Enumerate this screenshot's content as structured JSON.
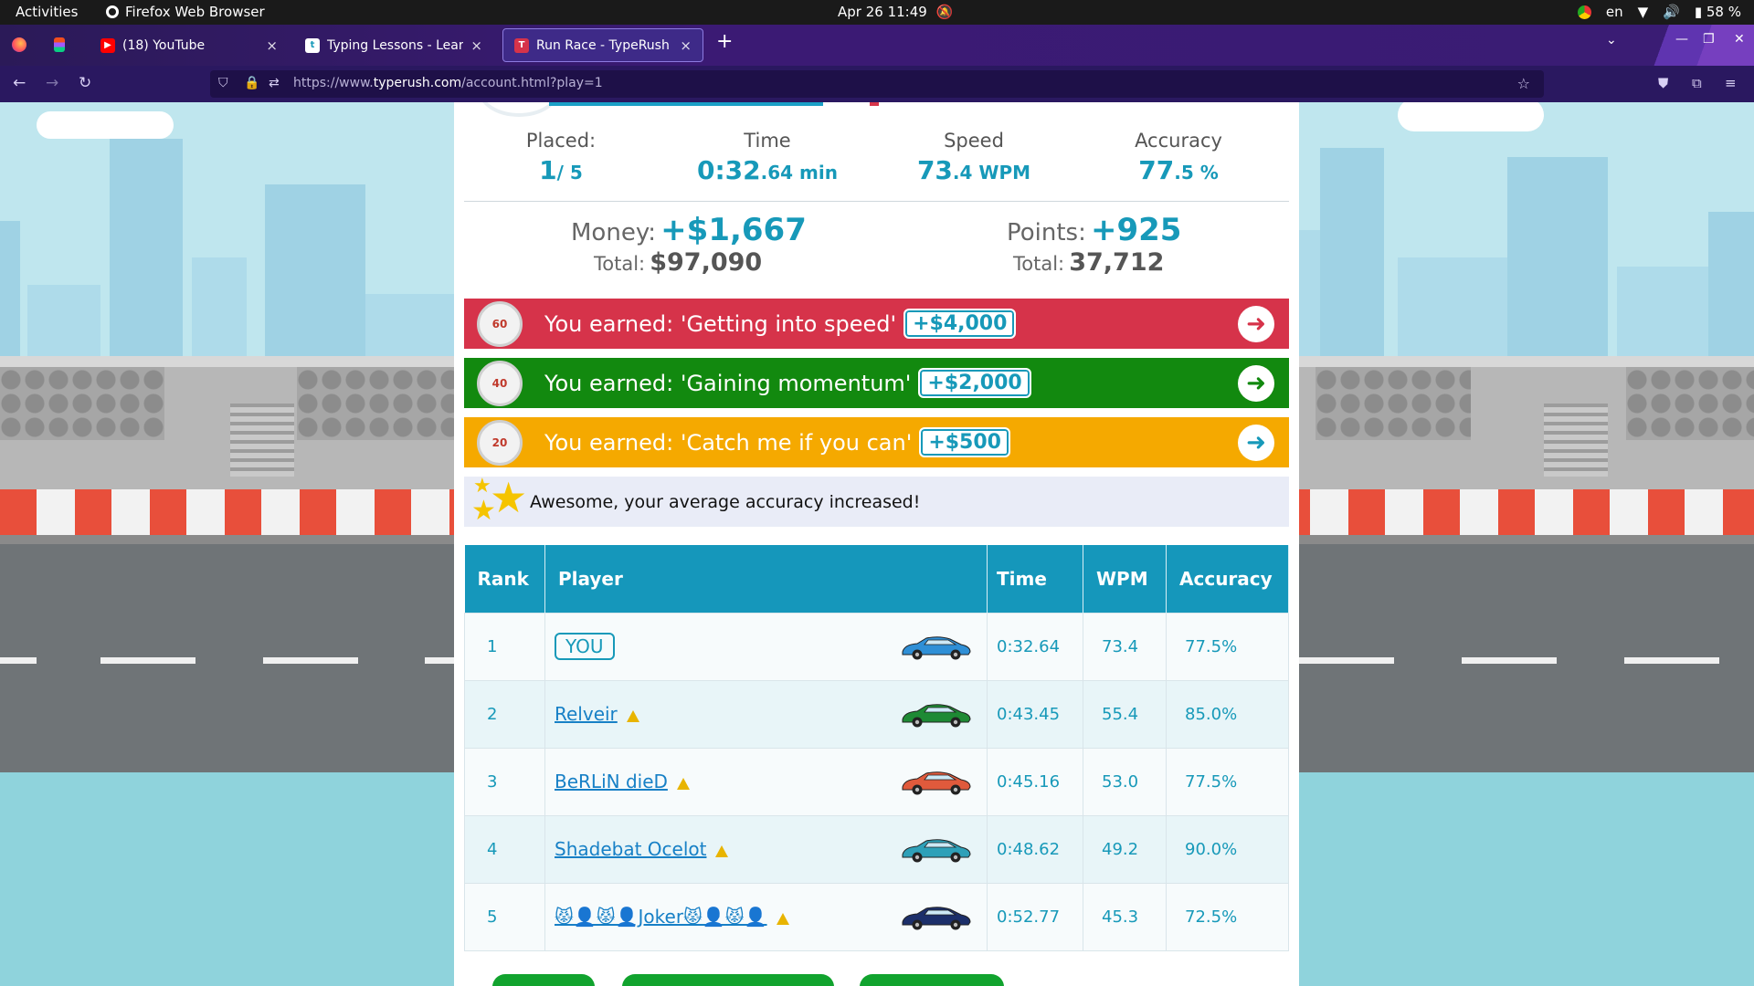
{
  "system": {
    "activities": "Activities",
    "app_name": "Firefox Web Browser",
    "datetime": "Apr 26  11:49",
    "language": "en",
    "battery": "58 %"
  },
  "tabs": [
    {
      "label": "(18) YouTube",
      "close": "×"
    },
    {
      "label": "Typing Lessons - Learn To",
      "close": "×"
    },
    {
      "label": "Run Race - TypeRush",
      "close": "×"
    }
  ],
  "newtab": "+",
  "nav": {
    "url_prefix": "https://www.",
    "url_domain": "typerush.com",
    "url_path": "/account.html?play=1"
  },
  "stats": {
    "placed_label": "Placed:",
    "placed_main": "1",
    "placed_suffix": "/ 5",
    "time_label": "Time",
    "time_main": "0:32",
    "time_suffix": ".64 min",
    "speed_label": "Speed",
    "speed_main": "73",
    "speed_suffix": ".4 WPM",
    "accuracy_label": "Accuracy",
    "accuracy_main": "77",
    "accuracy_suffix": ".5 %"
  },
  "rewards": {
    "money_label": "Money:",
    "money_value": "+$1,667",
    "money_total_label": "Total:",
    "money_total": "$97,090",
    "points_label": "Points:",
    "points_value": "+925",
    "points_total_label": "Total:",
    "points_total": "37,712"
  },
  "awards": [
    {
      "text": "You earned: 'Getting into speed'",
      "bonus": "+$4,000",
      "badge": "60",
      "color": "#d6334a"
    },
    {
      "text": "You earned: 'Gaining momentum'",
      "bonus": "+$2,000",
      "badge": "40",
      "color": "#12890f"
    },
    {
      "text": "You earned: 'Catch me if you can'",
      "bonus": "+$500",
      "badge": "20",
      "color": "#f5a900"
    }
  ],
  "notice": "Awesome, your average accuracy increased!",
  "table": {
    "headers": [
      "Rank",
      "Player",
      "Time",
      "WPM",
      "Accuracy"
    ],
    "rows": [
      {
        "rank": "1",
        "player": "YOU",
        "time": "0:32.64",
        "wpm": "73.4",
        "accuracy": "77.5%",
        "car_color": "#2f8fd6"
      },
      {
        "rank": "2",
        "player": "Relveir",
        "time": "0:43.45",
        "wpm": "55.4",
        "accuracy": "85.0%",
        "car_color": "#1e8a34"
      },
      {
        "rank": "3",
        "player": "BeRLiN dieD",
        "time": "0:45.16",
        "wpm": "53.0",
        "accuracy": "77.5%",
        "car_color": "#e05a3c"
      },
      {
        "rank": "4",
        "player": "Shadebat Ocelot",
        "time": "0:48.62",
        "wpm": "49.2",
        "accuracy": "90.0%",
        "car_color": "#2ea0b8"
      },
      {
        "rank": "5",
        "player": "😾👤😾👤Joker😾👤😾👤",
        "time": "0:52.77",
        "wpm": "45.3",
        "accuracy": "72.5%",
        "car_color": "#1c2f6a"
      }
    ]
  }
}
